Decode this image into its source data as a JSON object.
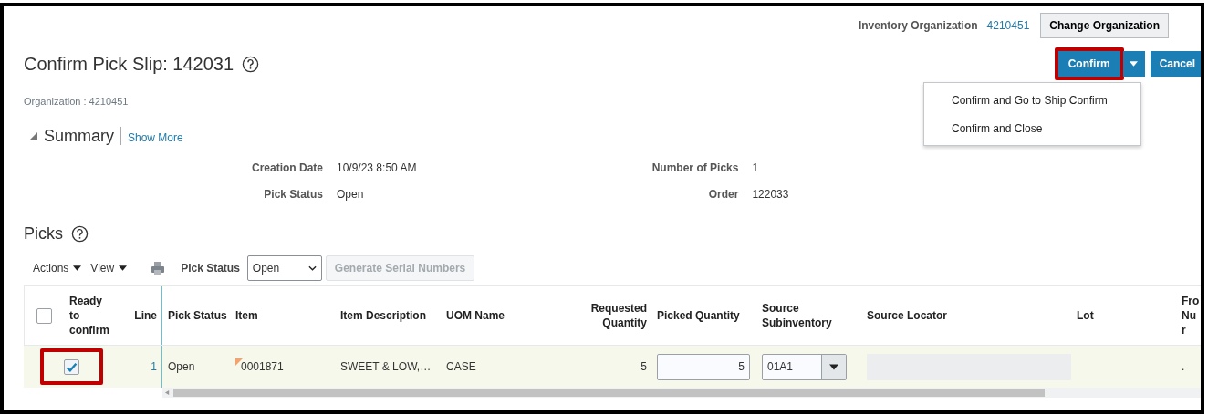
{
  "header": {
    "org_label": "Inventory Organization",
    "org_value": "4210451",
    "change_button": "Change Organization"
  },
  "page": {
    "title": "Confirm Pick Slip: 142031",
    "organization": "Organization : 4210451"
  },
  "actions": {
    "confirm": {
      "label": "Confirm",
      "highlighted": true
    },
    "cancel": "Cancel"
  },
  "menu": {
    "expanded": true,
    "items": [
      "Confirm and Go to Ship Confirm",
      "Confirm and Close"
    ]
  },
  "summary": {
    "title": "Summary",
    "expanded": true,
    "show_more": "Show More",
    "left_fields": [
      {
        "label": "Creation Date",
        "value": "10/9/23 8:50 AM"
      },
      {
        "label": "Pick Status",
        "value": "Open"
      }
    ],
    "right_fields": [
      {
        "label": "Number of Picks",
        "value": "1"
      },
      {
        "label": "Order",
        "value": "122033"
      }
    ]
  },
  "picks": {
    "title": "Picks",
    "toolbar": {
      "actions": "Actions",
      "view": "View",
      "filter_label": "Pick Status",
      "filter_value": "Open",
      "generate_button": {
        "label": "Generate Serial Numbers",
        "disabled": true
      }
    },
    "table": {
      "select_all_checked": false,
      "columns": [
        "Ready to confirm",
        "Line",
        "Pick Status",
        "Item",
        "Item Description",
        "UOM Name",
        "Requested Quantity",
        "Picked Quantity",
        "Source Subinventory",
        "Source Locator",
        "Lot",
        "Fro Nur"
      ],
      "rows": [
        {
          "ready": true,
          "highlighted": true,
          "line": "1",
          "pick_status": "Open",
          "item": "0001871",
          "description": "SWEET & LOW,…",
          "uom": "CASE",
          "requested": "5",
          "picked": "5",
          "subinventory": "01A1",
          "column_12": "."
        }
      ]
    }
  }
}
